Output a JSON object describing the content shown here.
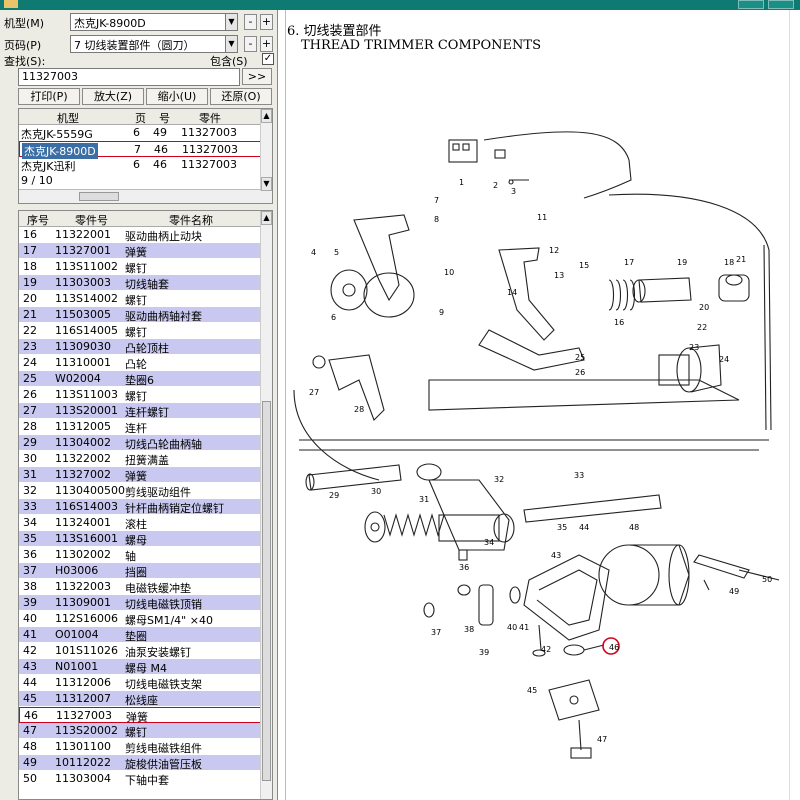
{
  "panel": {
    "model_label": "机型(M)",
    "model_value": "杰克JK-8900D",
    "page_label": "页码(P)",
    "page_value": "7 切线装置部件（圆刀）",
    "search_label": "查找(S):",
    "contains_label": "包含(S)",
    "contains_checked": "✓",
    "search_value": "11327003",
    "go_label": ">>",
    "buttons": {
      "print": "打印(P)",
      "zoom_in": "放大(Z)",
      "zoom_out": "缩小(U)",
      "restore": "还原(O)"
    },
    "results": {
      "headers": [
        "机型",
        "页",
        "号",
        "零件"
      ],
      "rows": [
        [
          "杰克JK-5559G",
          "6",
          "49",
          "11327003"
        ],
        [
          "杰克JK-8900D",
          "7",
          "46",
          "11327003"
        ],
        [
          "杰克JK迅利",
          "6",
          "46",
          "11327003"
        ]
      ],
      "count": "9 / 10"
    },
    "parts": {
      "headers": [
        "序号",
        "零件号",
        "零件名称"
      ],
      "rows": [
        [
          "16",
          "11322001",
          "驱动曲柄止动块"
        ],
        [
          "17",
          "11327001",
          "弹簧"
        ],
        [
          "18",
          "113S11002",
          "螺钉"
        ],
        [
          "19",
          "11303003",
          "切线轴套"
        ],
        [
          "20",
          "113S14002",
          "螺钉"
        ],
        [
          "21",
          "11503005",
          "驱动曲柄轴衬套"
        ],
        [
          "22",
          "116S14005",
          "螺钉"
        ],
        [
          "23",
          "11309030",
          "凸轮顶柱"
        ],
        [
          "24",
          "11310001",
          "凸轮"
        ],
        [
          "25",
          "W02004",
          "垫圈6"
        ],
        [
          "26",
          "113S11003",
          "螺钉"
        ],
        [
          "27",
          "113S20001",
          "连杆螺钉"
        ],
        [
          "28",
          "11312005",
          "连杆"
        ],
        [
          "29",
          "11304002",
          "切线凸轮曲柄轴"
        ],
        [
          "30",
          "11322002",
          "扭簧满盖"
        ],
        [
          "31",
          "11327002",
          "弹簧"
        ],
        [
          "32",
          "1130400500",
          "剪线驱动组件"
        ],
        [
          "33",
          "116S14003",
          "针杆曲柄销定位螺钉"
        ],
        [
          "34",
          "11324001",
          "滚柱"
        ],
        [
          "35",
          "113S16001",
          "螺母"
        ],
        [
          "36",
          "11302002",
          "轴"
        ],
        [
          "37",
          "H03006",
          "挡圈"
        ],
        [
          "38",
          "11322003",
          "电磁铁缓冲垫"
        ],
        [
          "39",
          "11309001",
          "切线电磁铁顶销"
        ],
        [
          "40",
          "112S16006",
          "螺母SM1/4\" ×40"
        ],
        [
          "41",
          "O01004",
          "垫圈"
        ],
        [
          "42",
          "101S11026",
          "油泵安装螺钉"
        ],
        [
          "43",
          "N01001",
          "螺母 M4"
        ],
        [
          "44",
          "11312006",
          "切线电磁铁支架"
        ],
        [
          "45",
          "11312007",
          "松线座"
        ],
        [
          "46",
          "11327003",
          "弹簧"
        ],
        [
          "47",
          "113S20002",
          "螺钉"
        ],
        [
          "48",
          "11301100",
          "剪线电磁铁组件"
        ],
        [
          "49",
          "10112022",
          "旋梭供油管压板"
        ],
        [
          "50",
          "11303004",
          "下轴中套"
        ]
      ]
    }
  },
  "diagram": {
    "title_cn": "6. 切线装置部件",
    "title_en": "THREAD TRIMMER COMPONENTS",
    "callouts": [
      "1",
      "2",
      "3",
      "4",
      "5",
      "6",
      "7",
      "8",
      "9",
      "10",
      "11",
      "12",
      "13",
      "14",
      "15",
      "16",
      "17",
      "18",
      "19",
      "20",
      "21",
      "22",
      "23",
      "24",
      "25",
      "26",
      "27",
      "28",
      "29",
      "30",
      "31",
      "32",
      "33",
      "34",
      "35",
      "36",
      "37",
      "38",
      "39",
      "40",
      "41",
      "42",
      "43",
      "44",
      "45",
      "46",
      "47",
      "48",
      "49",
      "50"
    ]
  },
  "colors": {
    "title_bar": "#0e7a72",
    "row_alt": "#c8c8f0",
    "selected": "#3a6ea5",
    "highlight_ring": "#d0021b"
  }
}
